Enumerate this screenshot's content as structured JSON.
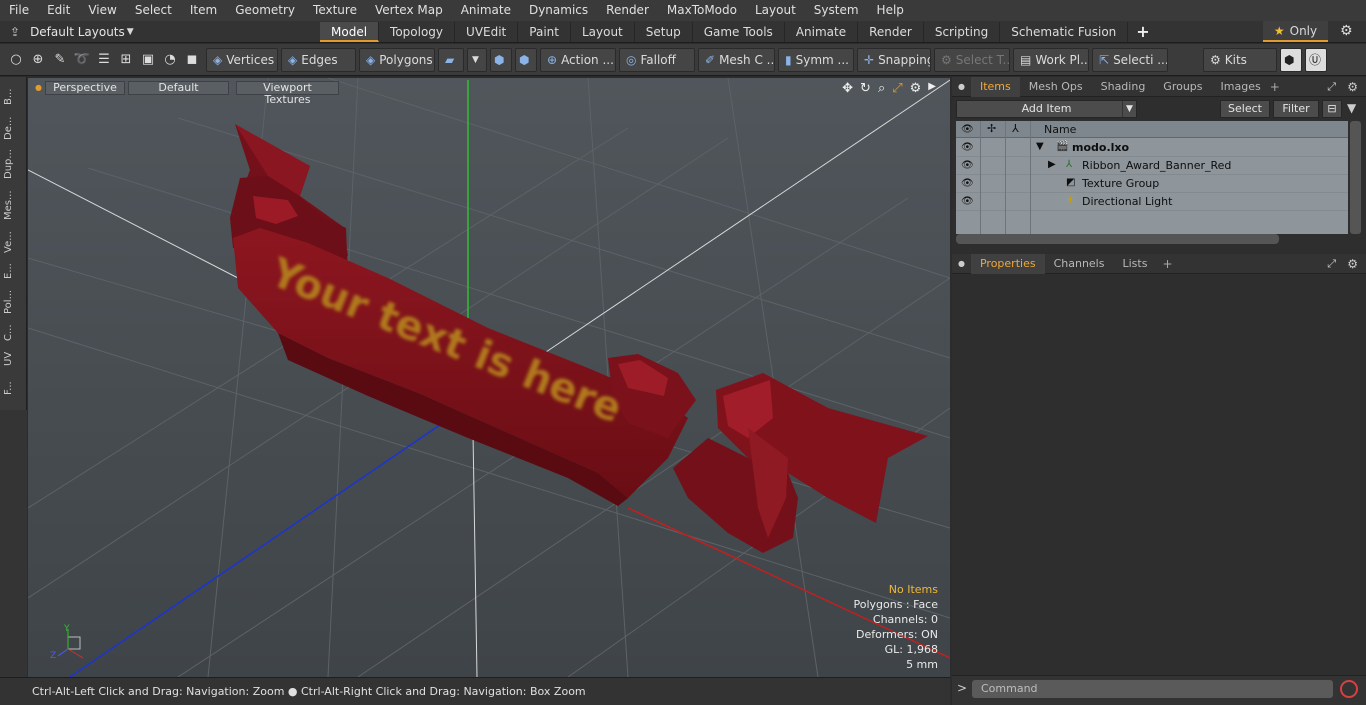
{
  "menu": [
    "File",
    "Edit",
    "View",
    "Select",
    "Item",
    "Geometry",
    "Texture",
    "Vertex Map",
    "Animate",
    "Dynamics",
    "Render",
    "MaxToModo",
    "Layout",
    "System",
    "Help"
  ],
  "layouts": {
    "label": "Default Layouts"
  },
  "tabs": [
    "Model",
    "Topology",
    "UVEdit",
    "Paint",
    "Layout",
    "Setup",
    "Game Tools",
    "Animate",
    "Render",
    "Scripting",
    "Schematic Fusion"
  ],
  "active_tab": "Model",
  "only_label": "Only",
  "toolbar": {
    "vertices": "Vertices",
    "edges": "Edges",
    "polygons": "Polygons",
    "action": "Action ...",
    "falloff": "Falloff",
    "mesh": "Mesh C ...",
    "symm": "Symm ...",
    "snapping": "Snapping",
    "select_t": "Select T...",
    "workpl": "Work Pl...",
    "selecti": "Selecti ...",
    "kits": "Kits"
  },
  "left_tabs": [
    "B...",
    "De...",
    "Dup...",
    "Mes...",
    "Ve...",
    "E...",
    "Pol...",
    "C...",
    "UV",
    "F..."
  ],
  "viewport": {
    "view": "Perspective",
    "shading": "Default",
    "textures": "Viewport Textures",
    "banner_text": "Your text is here",
    "info": {
      "items": "No Items",
      "polygons": "Polygons : Face",
      "channels": "Channels: 0",
      "deformers": "Deformers: ON",
      "gl": "GL: 1,968",
      "scale": "5 mm"
    },
    "axis_labels": {
      "y": "Y",
      "z": "Z"
    }
  },
  "status": "Ctrl-Alt-Left Click and Drag: Navigation: Zoom ● Ctrl-Alt-Right Click and Drag: Navigation: Box Zoom",
  "items_panel": {
    "tabs": [
      "Items",
      "Mesh Ops",
      "Shading",
      "Groups",
      "Images"
    ],
    "active": "Items",
    "add_item": "Add Item",
    "select": "Select",
    "filter": "Filter",
    "name_header": "Name",
    "rows": [
      {
        "label": "modo.lxo"
      },
      {
        "label": "Ribbon_Award_Banner_Red"
      },
      {
        "label": "Texture Group"
      },
      {
        "label": "Directional Light"
      }
    ]
  },
  "props_panel": {
    "tabs": [
      "Properties",
      "Channels",
      "Lists"
    ],
    "active": "Properties"
  },
  "command": {
    "placeholder": "Command"
  },
  "colors": {
    "accent": "#e29b2c",
    "banner": "#7c1018",
    "banner_text": "#b0781c"
  }
}
